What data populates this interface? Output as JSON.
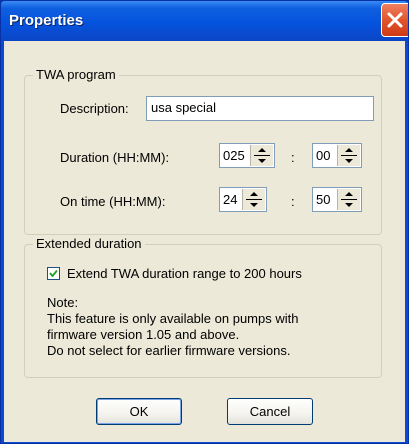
{
  "window": {
    "title": "Properties"
  },
  "twa_program": {
    "group_title": "TWA program",
    "description_label": "Description:",
    "description_value": "usa special",
    "duration_label": "Duration (HH:MM):",
    "duration_hours": "025",
    "duration_minutes": "00",
    "on_time_label": "On time (HH:MM):",
    "on_time_hours": "24",
    "on_time_minutes": "50",
    "separator": ":"
  },
  "extended_duration": {
    "group_title": "Extended duration",
    "checkbox_label": "Extend TWA duration range to 200 hours",
    "checked": true,
    "note_title": "Note:",
    "note_lines": [
      "This feature is only available on pumps with",
      "firmware version 1.05 and above.",
      "Do not select for earlier firmware versions."
    ]
  },
  "buttons": {
    "ok": "OK",
    "cancel": "Cancel"
  }
}
